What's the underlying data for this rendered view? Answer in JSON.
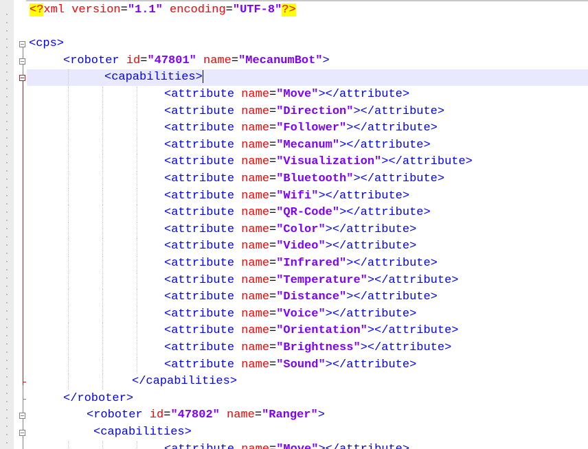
{
  "editor": {
    "lines": [
      {
        "segments": [
          {
            "k": "pi",
            "t": "<?"
          },
          {
            "k": "pi-text",
            "t": "xml version"
          },
          {
            "k": "eq",
            "t": "="
          },
          {
            "k": "val",
            "t": "\"1.1\""
          },
          {
            "k": "pi-text",
            "t": " encoding"
          },
          {
            "k": "eq",
            "t": "="
          },
          {
            "k": "val",
            "t": "\"UTF-8\""
          },
          {
            "k": "pi",
            "t": "?>"
          }
        ]
      },
      {
        "segments": []
      },
      {
        "segments": [
          {
            "k": "tag",
            "t": "<cps>"
          }
        ]
      },
      {
        "segments": [
          {
            "k": "tag",
            "t": "<roboter "
          },
          {
            "k": "attr",
            "t": "id"
          },
          {
            "k": "eq",
            "t": "="
          },
          {
            "k": "val",
            "t": "\"47801\""
          },
          {
            "k": "attr",
            "t": " name"
          },
          {
            "k": "eq",
            "t": "="
          },
          {
            "k": "val",
            "t": "\"MecanumBot\""
          },
          {
            "k": "tag",
            "t": ">"
          }
        ]
      },
      {
        "segments": [
          {
            "k": "tag",
            "t": "<capabilities>"
          }
        ],
        "current": true
      },
      {
        "segments": [
          {
            "k": "tag",
            "t": "<attribute "
          },
          {
            "k": "attr",
            "t": "name"
          },
          {
            "k": "eq",
            "t": "="
          },
          {
            "k": "val",
            "t": "\"Move\""
          },
          {
            "k": "tag",
            "t": "></attribute>"
          }
        ]
      },
      {
        "segments": [
          {
            "k": "tag",
            "t": "<attribute "
          },
          {
            "k": "attr",
            "t": "name"
          },
          {
            "k": "eq",
            "t": "="
          },
          {
            "k": "val",
            "t": "\"Direction\""
          },
          {
            "k": "tag",
            "t": "></attribute>"
          }
        ]
      },
      {
        "segments": [
          {
            "k": "tag",
            "t": "<attribute "
          },
          {
            "k": "attr",
            "t": "name"
          },
          {
            "k": "eq",
            "t": "="
          },
          {
            "k": "val",
            "t": "\"Follower\""
          },
          {
            "k": "tag",
            "t": "></attribute>"
          }
        ]
      },
      {
        "segments": [
          {
            "k": "tag",
            "t": "<attribute "
          },
          {
            "k": "attr",
            "t": "name"
          },
          {
            "k": "eq",
            "t": "="
          },
          {
            "k": "val",
            "t": "\"Mecanum\""
          },
          {
            "k": "tag",
            "t": "></attribute>"
          }
        ]
      },
      {
        "segments": [
          {
            "k": "tag",
            "t": "<attribute "
          },
          {
            "k": "attr",
            "t": "name"
          },
          {
            "k": "eq",
            "t": "="
          },
          {
            "k": "val",
            "t": "\"Visualization\""
          },
          {
            "k": "tag",
            "t": "></attribute>"
          }
        ]
      },
      {
        "segments": [
          {
            "k": "tag",
            "t": "<attribute "
          },
          {
            "k": "attr",
            "t": "name"
          },
          {
            "k": "eq",
            "t": "="
          },
          {
            "k": "val",
            "t": "\"Bluetooth\""
          },
          {
            "k": "tag",
            "t": "></attribute>"
          }
        ]
      },
      {
        "segments": [
          {
            "k": "tag",
            "t": "<attribute "
          },
          {
            "k": "attr",
            "t": "name"
          },
          {
            "k": "eq",
            "t": "="
          },
          {
            "k": "val",
            "t": "\"Wifi\""
          },
          {
            "k": "tag",
            "t": "></attribute>"
          }
        ]
      },
      {
        "segments": [
          {
            "k": "tag",
            "t": "<attribute "
          },
          {
            "k": "attr",
            "t": "name"
          },
          {
            "k": "eq",
            "t": "="
          },
          {
            "k": "val",
            "t": "\"QR-Code\""
          },
          {
            "k": "tag",
            "t": "></attribute>"
          }
        ]
      },
      {
        "segments": [
          {
            "k": "tag",
            "t": "<attribute "
          },
          {
            "k": "attr",
            "t": "name"
          },
          {
            "k": "eq",
            "t": "="
          },
          {
            "k": "val",
            "t": "\"Color\""
          },
          {
            "k": "tag",
            "t": "></attribute>"
          }
        ]
      },
      {
        "segments": [
          {
            "k": "tag",
            "t": "<attribute "
          },
          {
            "k": "attr",
            "t": "name"
          },
          {
            "k": "eq",
            "t": "="
          },
          {
            "k": "val",
            "t": "\"Video\""
          },
          {
            "k": "tag",
            "t": "></attribute>"
          }
        ]
      },
      {
        "segments": [
          {
            "k": "tag",
            "t": "<attribute "
          },
          {
            "k": "attr",
            "t": "name"
          },
          {
            "k": "eq",
            "t": "="
          },
          {
            "k": "val",
            "t": "\"Infrared\""
          },
          {
            "k": "tag",
            "t": "></attribute>"
          }
        ]
      },
      {
        "segments": [
          {
            "k": "tag",
            "t": "<attribute "
          },
          {
            "k": "attr",
            "t": "name"
          },
          {
            "k": "eq",
            "t": "="
          },
          {
            "k": "val",
            "t": "\"Temperature\""
          },
          {
            "k": "tag",
            "t": "></attribute>"
          }
        ]
      },
      {
        "segments": [
          {
            "k": "tag",
            "t": "<attribute "
          },
          {
            "k": "attr",
            "t": "name"
          },
          {
            "k": "eq",
            "t": "="
          },
          {
            "k": "val",
            "t": "\"Distance\""
          },
          {
            "k": "tag",
            "t": "></attribute>"
          }
        ]
      },
      {
        "segments": [
          {
            "k": "tag",
            "t": "<attribute "
          },
          {
            "k": "attr",
            "t": "name"
          },
          {
            "k": "eq",
            "t": "="
          },
          {
            "k": "val",
            "t": "\"Voice\""
          },
          {
            "k": "tag",
            "t": "></attribute>"
          }
        ]
      },
      {
        "segments": [
          {
            "k": "tag",
            "t": "<attribute "
          },
          {
            "k": "attr",
            "t": "name"
          },
          {
            "k": "eq",
            "t": "="
          },
          {
            "k": "val",
            "t": "\"Orientation\""
          },
          {
            "k": "tag",
            "t": "></attribute>"
          }
        ]
      },
      {
        "segments": [
          {
            "k": "tag",
            "t": "<attribute "
          },
          {
            "k": "attr",
            "t": "name"
          },
          {
            "k": "eq",
            "t": "="
          },
          {
            "k": "val",
            "t": "\"Brightness\""
          },
          {
            "k": "tag",
            "t": "></attribute>"
          }
        ]
      },
      {
        "segments": [
          {
            "k": "tag",
            "t": "<attribute "
          },
          {
            "k": "attr",
            "t": "name"
          },
          {
            "k": "eq",
            "t": "="
          },
          {
            "k": "val",
            "t": "\"Sound\""
          },
          {
            "k": "tag",
            "t": "></attribute>"
          }
        ]
      },
      {
        "segments": [
          {
            "k": "tag",
            "t": "</capabilities>"
          }
        ]
      },
      {
        "segments": [
          {
            "k": "tag",
            "t": "</roboter>"
          }
        ]
      },
      {
        "segments": [
          {
            "k": "tag",
            "t": "<roboter "
          },
          {
            "k": "attr",
            "t": "id"
          },
          {
            "k": "eq",
            "t": "="
          },
          {
            "k": "val",
            "t": "\"47802\""
          },
          {
            "k": "attr",
            "t": " name"
          },
          {
            "k": "eq",
            "t": "="
          },
          {
            "k": "val",
            "t": "\"Ranger\""
          },
          {
            "k": "tag",
            "t": ">"
          }
        ]
      },
      {
        "segments": [
          {
            "k": "tag",
            "t": "<capabilities>"
          }
        ]
      },
      {
        "segments": [
          {
            "k": "tag",
            "t": "<attribute "
          },
          {
            "k": "attr",
            "t": "name"
          },
          {
            "k": "eq",
            "t": "="
          },
          {
            "k": "val",
            "t": "\"Move\""
          },
          {
            "k": "tag",
            "t": "></attribute>"
          }
        ]
      }
    ]
  },
  "colors": {
    "tag": "#0000ff",
    "attribute": "#ff0000",
    "value": "#8000ff",
    "pi_highlight": "#ffff00",
    "current_line": "#e8e8ff",
    "fold_active": "#d01010"
  }
}
